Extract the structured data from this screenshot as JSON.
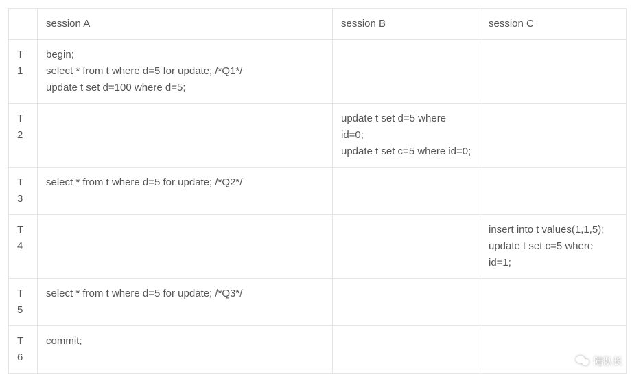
{
  "table": {
    "headers": {
      "step": "",
      "a": "session A",
      "b": "session B",
      "c": "session C"
    },
    "rows": [
      {
        "step": "T1",
        "a": "begin;\nselect * from t where d=5 for update; /*Q1*/\nupdate t set d=100 where d=5;",
        "b": "",
        "c": ""
      },
      {
        "step": "T2",
        "a": "",
        "b": "update t set d=5 where id=0;\nupdate t set c=5 where id=0;",
        "c": ""
      },
      {
        "step": "T3",
        "a": "select * from t where d=5 for update; /*Q2*/",
        "b": "",
        "c": ""
      },
      {
        "step": "T4",
        "a": "",
        "b": "",
        "c": "insert into t values(1,1,5);\nupdate t set c=5 where id=1;"
      },
      {
        "step": "T5",
        "a": "select * from t where d=5 for update; /*Q3*/",
        "b": "",
        "c": ""
      },
      {
        "step": "T6",
        "a": "commit;",
        "b": "",
        "c": ""
      }
    ]
  },
  "watermark": {
    "text": "陆队长"
  }
}
